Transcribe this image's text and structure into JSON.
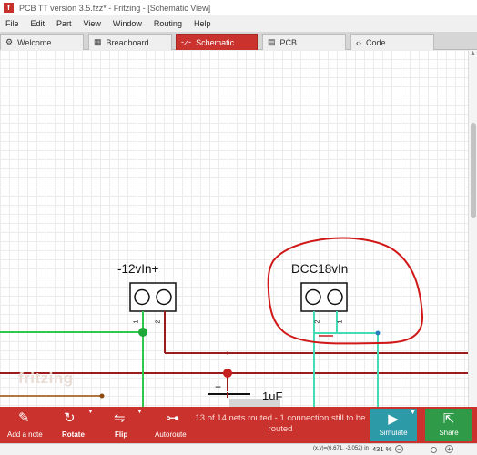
{
  "window": {
    "title": "PCB TT version 3.5.fzz* - Fritzing - [Schematic View]",
    "app_icon": "f"
  },
  "menu": [
    "File",
    "Edit",
    "Part",
    "View",
    "Window",
    "Routing",
    "Help"
  ],
  "tabs": [
    {
      "label": "Welcome",
      "icon": "⚙"
    },
    {
      "label": "Breadboard",
      "icon": "▦"
    },
    {
      "label": "Schematic",
      "icon": "-⩘-",
      "active": true
    },
    {
      "label": "PCB",
      "icon": "▤"
    },
    {
      "label": "Code",
      "icon": "‹›"
    }
  ],
  "schematic": {
    "parts": [
      {
        "label": "-12vIn+",
        "pin1": "1",
        "pin2": "2"
      },
      {
        "label": "DCC18vIn",
        "pin1": "2",
        "pin2": "1"
      }
    ],
    "capacitor": {
      "label": "1uF",
      "plus": "+"
    },
    "watermark": "fritzing",
    "colors": {
      "trace_red": "#9b1c1c",
      "trace_green": "#2ec84a",
      "trace_cyan": "#43dcb7",
      "annotation": "#d01818"
    }
  },
  "toolbar": {
    "add_note": "Add a note",
    "rotate": "Rotate",
    "flip": "Flip",
    "autoroute": "Autoroute",
    "routing_status": "13 of 14 nets routed - 1 connection still to be routed",
    "simulate": "Simulate",
    "share": "Share"
  },
  "statusbar": {
    "coordinates": "(x,y)=(6.671, -3.052) in",
    "zoom": "431 %",
    "zoom_level_percent": 431
  }
}
